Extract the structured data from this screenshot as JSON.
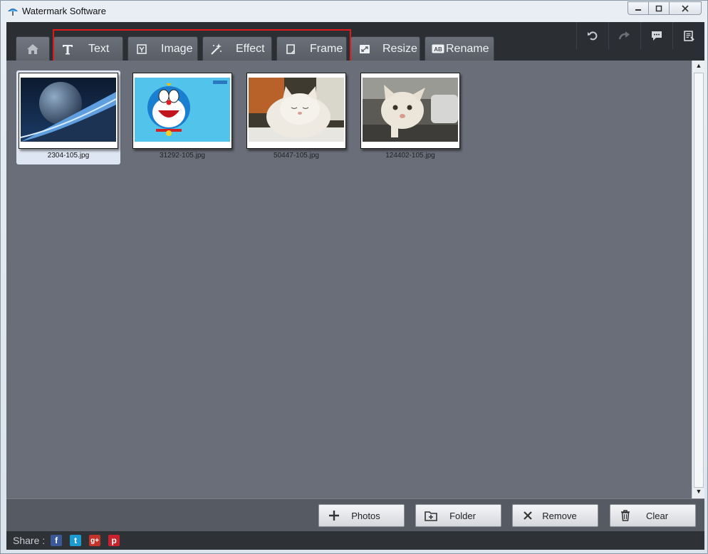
{
  "window": {
    "title": "Watermark Software"
  },
  "tabs": [
    {
      "id": "home",
      "label": "",
      "icon": "home-icon"
    },
    {
      "id": "text",
      "label": "Text",
      "icon": "text-icon"
    },
    {
      "id": "image",
      "label": "Image",
      "icon": "image-icon"
    },
    {
      "id": "effect",
      "label": "Effect",
      "icon": "magic-wand-icon"
    },
    {
      "id": "frame",
      "label": "Frame",
      "icon": "frame-icon"
    },
    {
      "id": "resize",
      "label": "Resize",
      "icon": "resize-icon"
    },
    {
      "id": "rename",
      "label": "Rename",
      "icon": "rename-icon"
    }
  ],
  "right_tools": [
    "undo-icon",
    "redo-icon",
    "chat-icon",
    "notes-icon"
  ],
  "thumbnails": [
    {
      "filename": "2304-105.jpg",
      "selected": true
    },
    {
      "filename": "31292-105.jpg",
      "selected": false
    },
    {
      "filename": "50447-105.jpg",
      "selected": false
    },
    {
      "filename": "124402-105.jpg",
      "selected": false
    }
  ],
  "actions": {
    "photos": "Photos",
    "folder": "Folder",
    "remove": "Remove",
    "clear": "Clear"
  },
  "share": {
    "label": "Share :",
    "networks": [
      {
        "icon": "facebook-icon",
        "glyph": "f",
        "color": "#3b5998"
      },
      {
        "icon": "twitter-icon",
        "glyph": "t",
        "color": "#1d9bd1"
      },
      {
        "icon": "google-plus-icon",
        "glyph": "g+",
        "color": "#c4322a"
      },
      {
        "icon": "pinterest-icon",
        "glyph": "p",
        "color": "#c8232c"
      }
    ]
  },
  "colors": {
    "highlight": "#e01b1b",
    "toolbar": "#2b2e33",
    "content_bg": "#6a6e78"
  }
}
